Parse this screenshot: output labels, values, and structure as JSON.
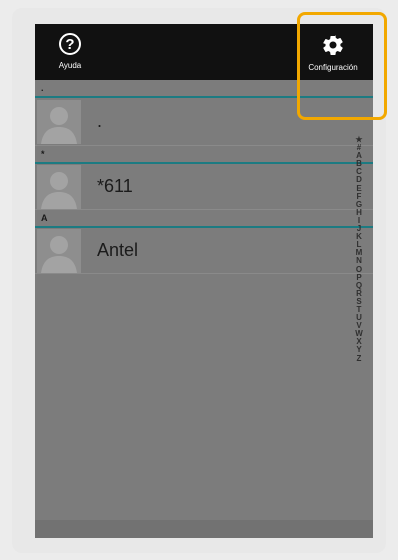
{
  "appbar": {
    "help_label": "Ayuda",
    "settings_label": "Configuración",
    "help_glyph": "?",
    "highlight_color": "#f2a800"
  },
  "contacts": {
    "groups": [
      {
        "header": ".",
        "name": "."
      },
      {
        "header": "*",
        "name": "*611"
      },
      {
        "header": "A",
        "name": "Antel"
      }
    ]
  },
  "index": {
    "letters": [
      "★",
      "#",
      "A",
      "B",
      "C",
      "D",
      "E",
      "F",
      "G",
      "H",
      "I",
      "J",
      "K",
      "L",
      "M",
      "N",
      "O",
      "P",
      "Q",
      "R",
      "S",
      "T",
      "U",
      "V",
      "W",
      "X",
      "Y",
      "Z"
    ]
  },
  "colors": {
    "accent": "#1c7b82",
    "topbar": "#111111",
    "screen": "#7c7c7c"
  }
}
